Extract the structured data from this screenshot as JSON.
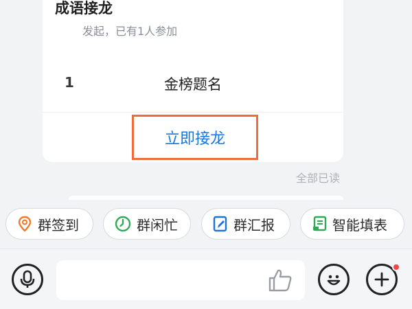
{
  "card": {
    "title": "成语接龙",
    "subtitle": "发起，已有1人参加",
    "entries": [
      {
        "index": "1",
        "text": "金榜题名"
      }
    ],
    "join_label": "立即接龙"
  },
  "read_status": "全部已读",
  "quick_actions": [
    {
      "label": "群签到",
      "icon": "location-pin-icon",
      "color": "#f07a2e"
    },
    {
      "label": "群闲忙",
      "icon": "clock-icon",
      "color": "#2eaa57"
    },
    {
      "label": "群汇报",
      "icon": "report-edit-icon",
      "color": "#1b72e0"
    },
    {
      "label": "智能填表",
      "icon": "form-fill-icon",
      "color": "#2eaa57"
    }
  ],
  "input_bar": {
    "voice_icon": "microphone-icon",
    "like_icon": "thumbs-up-icon",
    "emoji_icon": "smiley-icon",
    "more_icon": "plus-icon",
    "badge_color": "#f24747"
  }
}
